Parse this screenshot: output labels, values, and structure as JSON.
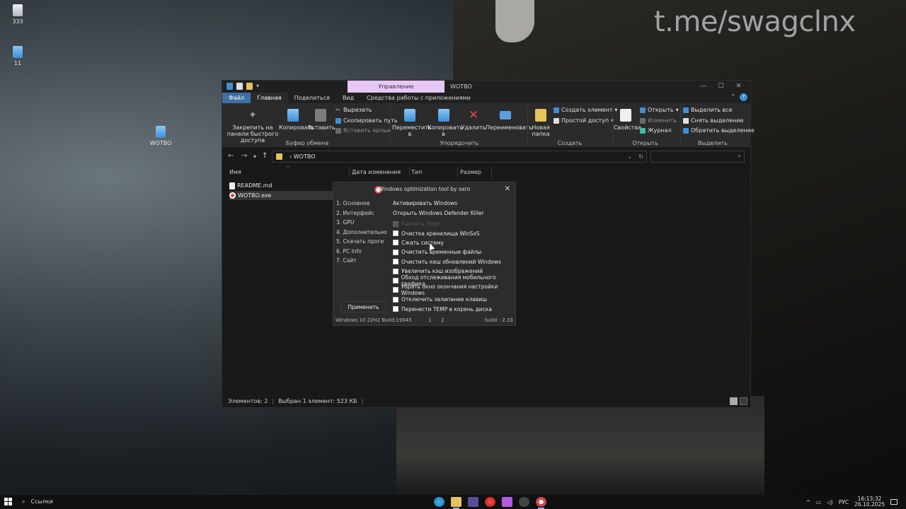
{
  "desktop": {
    "watermark": "t.me/swagclnx",
    "icons": [
      {
        "label": "333"
      },
      {
        "label": "11"
      },
      {
        "label": "WOTBO"
      }
    ]
  },
  "explorer": {
    "context_tab": "Управление",
    "window_title": "WOTBO",
    "window_buttons": [
      "—",
      "☐",
      "✕"
    ],
    "menu": [
      "Файл",
      "Главная",
      "Поделиться",
      "Вид",
      "Средства работы с приложениями"
    ],
    "ribbon": {
      "pin": "Закрепить на панели быстрого доступа",
      "copy": "Копировать",
      "paste": "Вставить",
      "cut": "Вырезать",
      "copy_path": "Скопировать путь",
      "paste_shortcut": "Вставить ярлык",
      "move_to": "Переместить в",
      "copy_to": "Копировать в",
      "delete": "Удалить",
      "rename": "Переименовать",
      "new_folder": "Новая папка",
      "new_item": "Создать элемент",
      "easy_access": "Простой доступ",
      "properties": "Свойства",
      "open": "Открыть",
      "edit": "Изменить",
      "history": "Журнал",
      "select_all": "Выделить все",
      "select_none": "Снять выделение",
      "invert": "Обратить выделение",
      "groups": [
        "Буфер обмена",
        "Упорядочить",
        "Создать",
        "Открыть",
        "Выделить"
      ]
    },
    "address": {
      "path": "WOTBO",
      "arrow": "›"
    },
    "columns": [
      "Имя",
      "Дата изменения",
      "Тип",
      "Размер"
    ],
    "files": [
      {
        "name": "README.md"
      },
      {
        "name": "WOTBO.exe"
      }
    ],
    "status": {
      "count": "Элементов: 2",
      "selected": "Выбран 1 элемент: 523 КБ"
    }
  },
  "dialog": {
    "title": "Windows optimization tool by oxro",
    "close": "✕",
    "nav": [
      "1. Основное",
      "2. Интерфейс",
      "3. GPU",
      "4. Дополнительно",
      "5. Скачать проги",
      "6. PC Info",
      "7. Сайт"
    ],
    "apply": "Применить",
    "links": [
      "Активировать Windows",
      "Открыть Windows Defender Killer"
    ],
    "checkboxes": [
      {
        "label": "Удалить Edge",
        "disabled": true
      },
      {
        "label": "Очистка хранилища WinSxS"
      },
      {
        "label": "Сжать систему"
      },
      {
        "label": "Очистить временные файлы"
      },
      {
        "label": "Очистить кеш обновлений Windows"
      },
      {
        "label": "Увеличить кэш изображений"
      },
      {
        "label": "Обход отслеживания мобильного трафика"
      },
      {
        "label": "Убрать окно окончания настройки Windows"
      },
      {
        "label": "Отключить залипание клавиш"
      },
      {
        "label": "Перенести TEMP в корень диска"
      }
    ],
    "footer": {
      "os": "Windows 10 22H2 Build:19045",
      "page1": "1",
      "page2": "2",
      "build": "build - 2.33"
    }
  },
  "taskbar": {
    "search_label": "Ссылки",
    "lang": "РУС",
    "time": "16:13:32",
    "date": "26.10.2025"
  }
}
